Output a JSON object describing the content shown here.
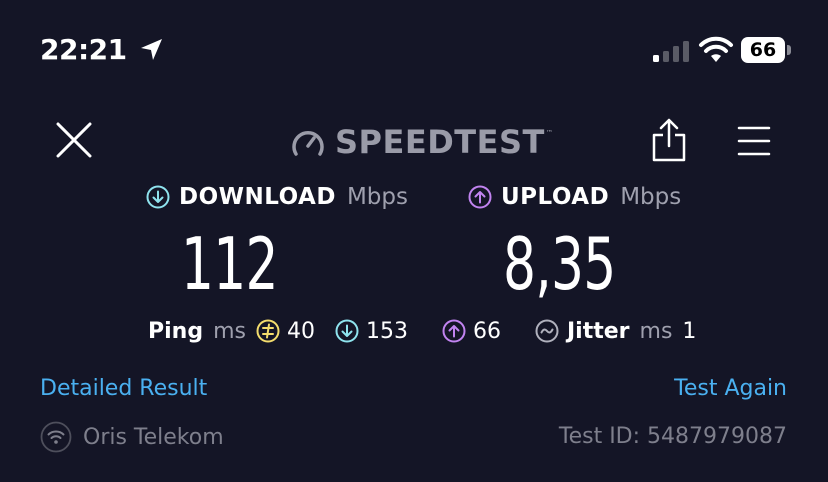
{
  "status_bar": {
    "time": "22:21",
    "battery": "66"
  },
  "header": {
    "brand": "SPEEDTEST",
    "brand_mark": "™"
  },
  "download": {
    "label": "DOWNLOAD",
    "unit": "Mbps",
    "value": "112"
  },
  "upload": {
    "label": "UPLOAD",
    "unit": "Mbps",
    "value": "8,35"
  },
  "ping": {
    "label": "Ping",
    "unit": "ms",
    "idle": "40",
    "download": "153",
    "upload": "66"
  },
  "jitter": {
    "label": "Jitter",
    "unit": "ms",
    "value": "1"
  },
  "links": {
    "detailed": "Detailed Result",
    "again": "Test Again"
  },
  "footer": {
    "isp": "Oris Telekom",
    "test_id": "Test ID: 5487979087"
  },
  "colors": {
    "background": "#141526",
    "download_accent": "#8fe3ee",
    "upload_accent": "#c183f0",
    "idle_ping": "#f3dc6d",
    "link": "#4ab0f0"
  },
  "icons": [
    "location-arrow-icon",
    "cell-signal-icon",
    "wifi-icon",
    "battery-icon",
    "close-icon",
    "speedometer-icon",
    "share-icon",
    "menu-icon",
    "download-arrow-icon",
    "upload-arrow-icon",
    "idle-ping-icon",
    "jitter-icon",
    "isp-wifi-icon"
  ]
}
